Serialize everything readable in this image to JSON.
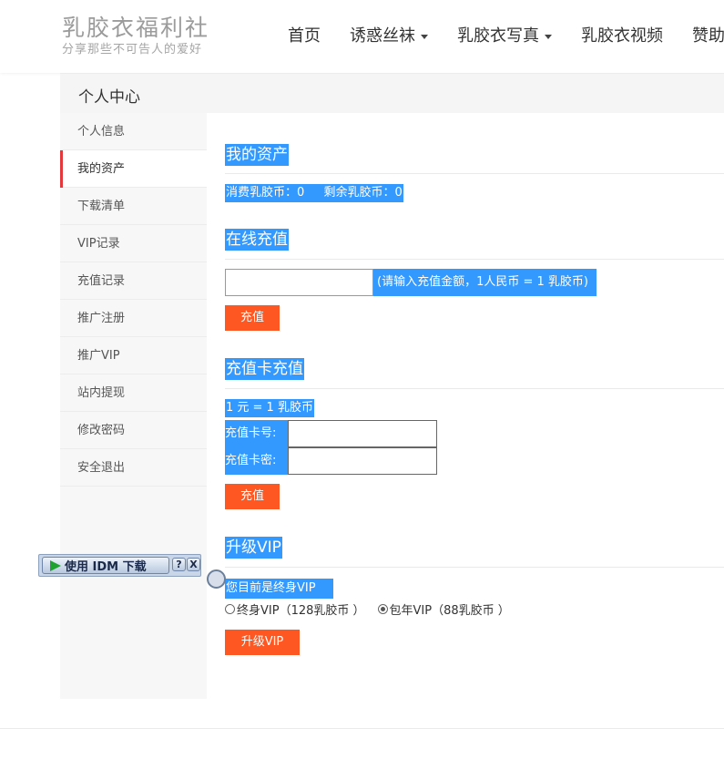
{
  "site": {
    "title": "乳胶衣福利社",
    "subtitle": "分享那些不可告人的爱好"
  },
  "nav": [
    {
      "label": "首页",
      "has_dropdown": false
    },
    {
      "label": "诱惑丝袜",
      "has_dropdown": true
    },
    {
      "label": "乳胶衣写真",
      "has_dropdown": true
    },
    {
      "label": "乳胶衣视频",
      "has_dropdown": false
    },
    {
      "label": "赞助会",
      "has_dropdown": false
    }
  ],
  "page": {
    "title": "个人中心"
  },
  "sidebar": {
    "items": [
      {
        "label": "个人信息"
      },
      {
        "label": "我的资产"
      },
      {
        "label": "下载清单"
      },
      {
        "label": "VIP记录"
      },
      {
        "label": "充值记录"
      },
      {
        "label": "推广注册"
      },
      {
        "label": "推广VIP"
      },
      {
        "label": "站内提现"
      },
      {
        "label": "修改密码"
      },
      {
        "label": "安全退出"
      }
    ],
    "active_index": 1
  },
  "assets": {
    "title": "我的资产",
    "summary": "消费乳胶币：0 　 剩余乳胶币：0"
  },
  "online_recharge": {
    "title": "在线充值",
    "amount_value": "",
    "hint": "(请输入充值金额，1人民币 = 1 乳胶币)",
    "button": "充值"
  },
  "card_recharge": {
    "title": "充值卡充值",
    "rate": "1 元 = 1 乳胶币",
    "card_no_label": "充值卡号:",
    "card_pwd_label": "充值卡密:",
    "card_no_value": "",
    "card_pwd_value": "",
    "button": "充值"
  },
  "upgrade_vip": {
    "title": "升级VIP",
    "status": "您目前是终身VIP",
    "options": [
      {
        "label": "终身VIP（128乳胶币 ）",
        "checked": false
      },
      {
        "label": "包年VIP（88乳胶币 ）",
        "checked": true
      }
    ],
    "button": "升级VIP"
  },
  "idm": {
    "label": "使用 IDM 下载",
    "help": "?",
    "close": "X"
  },
  "colors": {
    "highlight": "#3399ff",
    "button": "#ff5722",
    "active_marker": "#e4393c"
  }
}
